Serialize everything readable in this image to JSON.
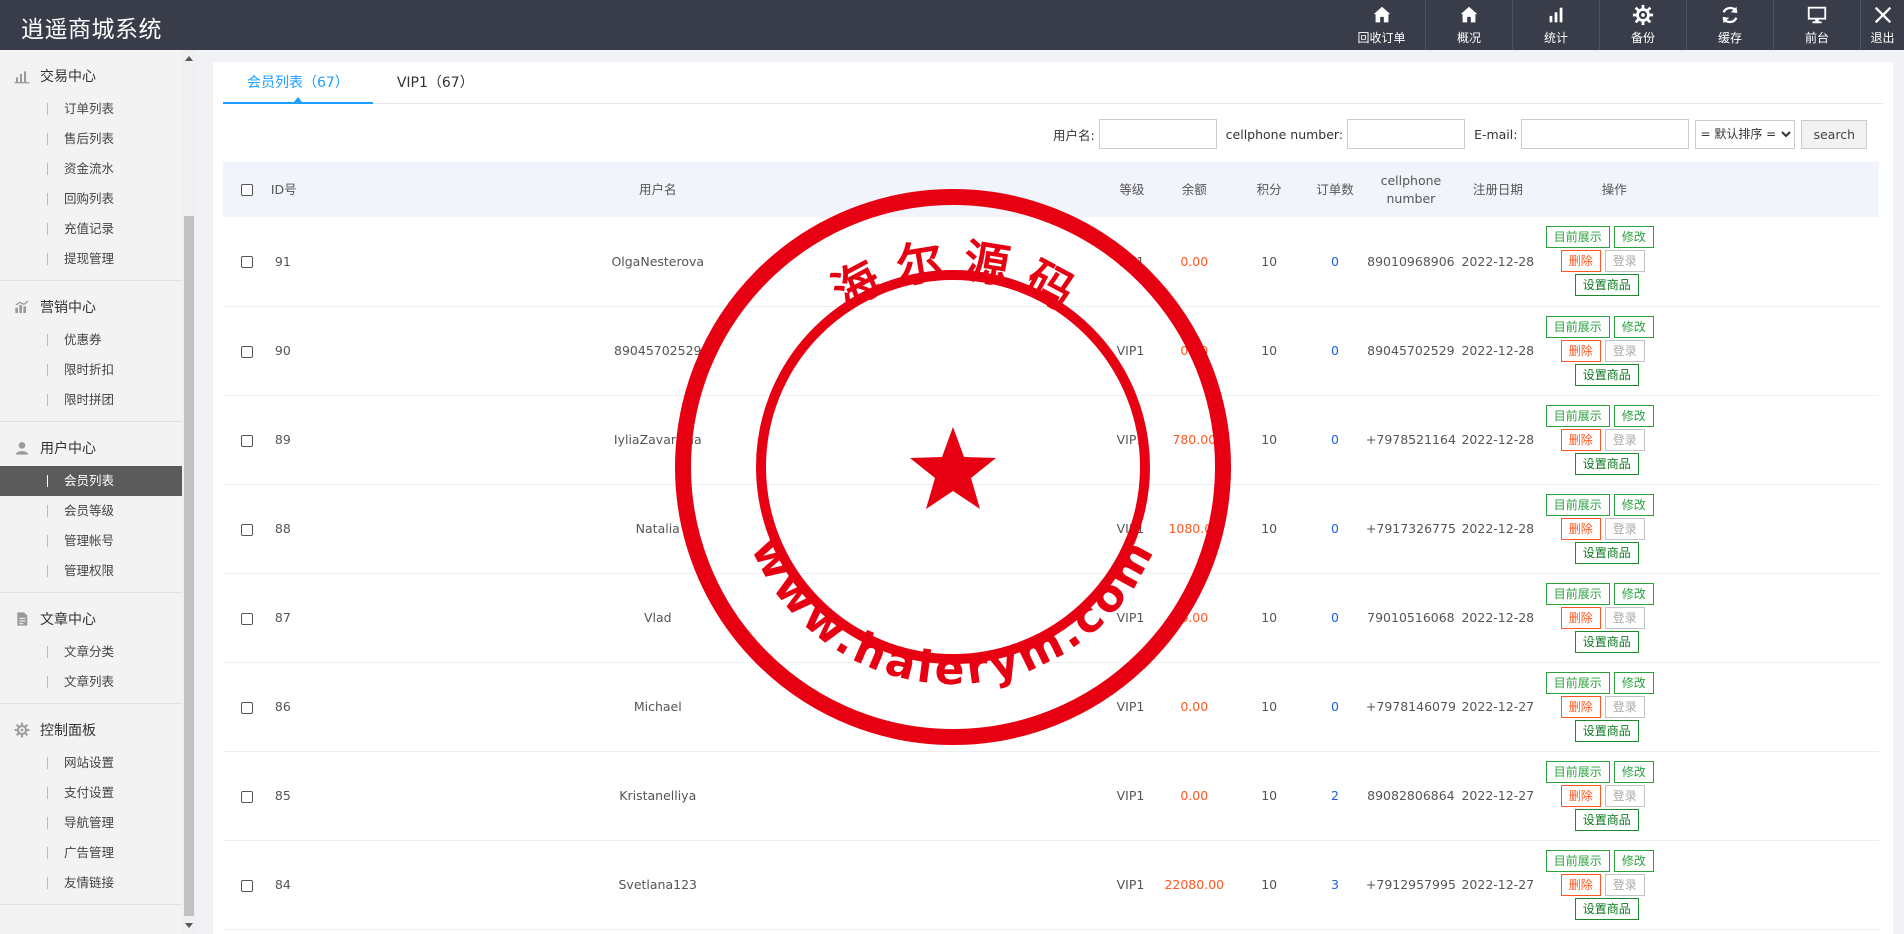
{
  "app": {
    "title": "逍遥商城系统"
  },
  "topnav": [
    {
      "icon": "home-icon",
      "label": "回收订单"
    },
    {
      "icon": "home-icon",
      "label": "概况"
    },
    {
      "icon": "bar-chart-icon",
      "label": "统计"
    },
    {
      "icon": "gear-icon",
      "label": "备份"
    },
    {
      "icon": "refresh-icon",
      "label": "缓存"
    },
    {
      "icon": "monitor-icon",
      "label": "前台"
    },
    {
      "icon": "close-icon",
      "label": "退出"
    }
  ],
  "sidebar": {
    "groups": [
      {
        "icon": "chart-icon",
        "title": "交易中心",
        "items": [
          "订单列表",
          "售后列表",
          "资金流水",
          "回购列表",
          "充值记录",
          "提现管理"
        ]
      },
      {
        "icon": "marketing-icon",
        "title": "营销中心",
        "items": [
          "优惠券",
          "限时折扣",
          "限时拼团"
        ]
      },
      {
        "icon": "user-icon",
        "title": "用户中心",
        "items": [
          "会员列表",
          "会员等级",
          "管理帐号",
          "管理权限"
        ]
      },
      {
        "icon": "document-icon",
        "title": "文章中心",
        "items": [
          "文章分类",
          "文章列表"
        ]
      },
      {
        "icon": "gear-icon",
        "title": "控制面板",
        "items": [
          "网站设置",
          "支付设置",
          "导航管理",
          "广告管理",
          "友情链接"
        ]
      }
    ],
    "active_item": "会员列表"
  },
  "tabs": [
    {
      "label": "会员列表（67）"
    },
    {
      "label": "VIP1（67）"
    }
  ],
  "search": {
    "username_label": "用户名:",
    "phone_label": "cellphone number:",
    "email_label": "E-mail:",
    "sort_selected": "= 默认排序 =",
    "search_button": "search"
  },
  "table": {
    "headers": {
      "id": "ID号",
      "username": "用户名",
      "level": "等级",
      "balance": "余额",
      "points": "积分",
      "orders": "订单数",
      "phone_line1": "cellphone",
      "phone_line2": "number",
      "date": "注册日期",
      "ops": "操作"
    },
    "buttons": {
      "show": "目前展示",
      "edit": "修改",
      "delete": "删除",
      "login": "登录",
      "goods": "设置商品"
    },
    "rows": [
      {
        "id": "91",
        "username": "OlgaNesterova",
        "level": "VIP1",
        "balance": "0.00",
        "points": "10",
        "orders": "0",
        "phone": "89010968906",
        "date": "2022-12-28"
      },
      {
        "id": "90",
        "username": "89045702529",
        "level": "VIP1",
        "balance": "0.00",
        "points": "10",
        "orders": "0",
        "phone": "89045702529",
        "date": "2022-12-28"
      },
      {
        "id": "89",
        "username": "IyliaZavarzina",
        "level": "VIP1",
        "balance": "780.00",
        "points": "10",
        "orders": "0",
        "phone": "+7978521164",
        "date": "2022-12-28"
      },
      {
        "id": "88",
        "username": "Natalia",
        "level": "VIP1",
        "balance": "1080.00",
        "points": "10",
        "orders": "0",
        "phone": "+7917326775",
        "date": "2022-12-28"
      },
      {
        "id": "87",
        "username": "Vlad",
        "level": "VIP1",
        "balance": "0.00",
        "points": "10",
        "orders": "0",
        "phone": "79010516068",
        "date": "2022-12-28"
      },
      {
        "id": "86",
        "username": "Michael",
        "level": "VIP1",
        "balance": "0.00",
        "points": "10",
        "orders": "0",
        "phone": "+7978146079",
        "date": "2022-12-27"
      },
      {
        "id": "85",
        "username": "Kristanelliya",
        "level": "VIP1",
        "balance": "0.00",
        "points": "10",
        "orders": "2",
        "phone": "89082806864",
        "date": "2022-12-27"
      },
      {
        "id": "84",
        "username": "Svetlana123",
        "level": "VIP1",
        "balance": "22080.00",
        "points": "10",
        "orders": "3",
        "phone": "+7912957995",
        "date": "2022-12-27"
      }
    ]
  },
  "watermark": {
    "top_text": "海 尔 源 码",
    "bottom_text": "www.haierym.com",
    "color": "#e60012"
  },
  "colors": {
    "accent": "#1e9fff",
    "topbar": "#393d49",
    "money": "#ff5722",
    "link": "#1e60d9",
    "green": "#2aa33d"
  }
}
